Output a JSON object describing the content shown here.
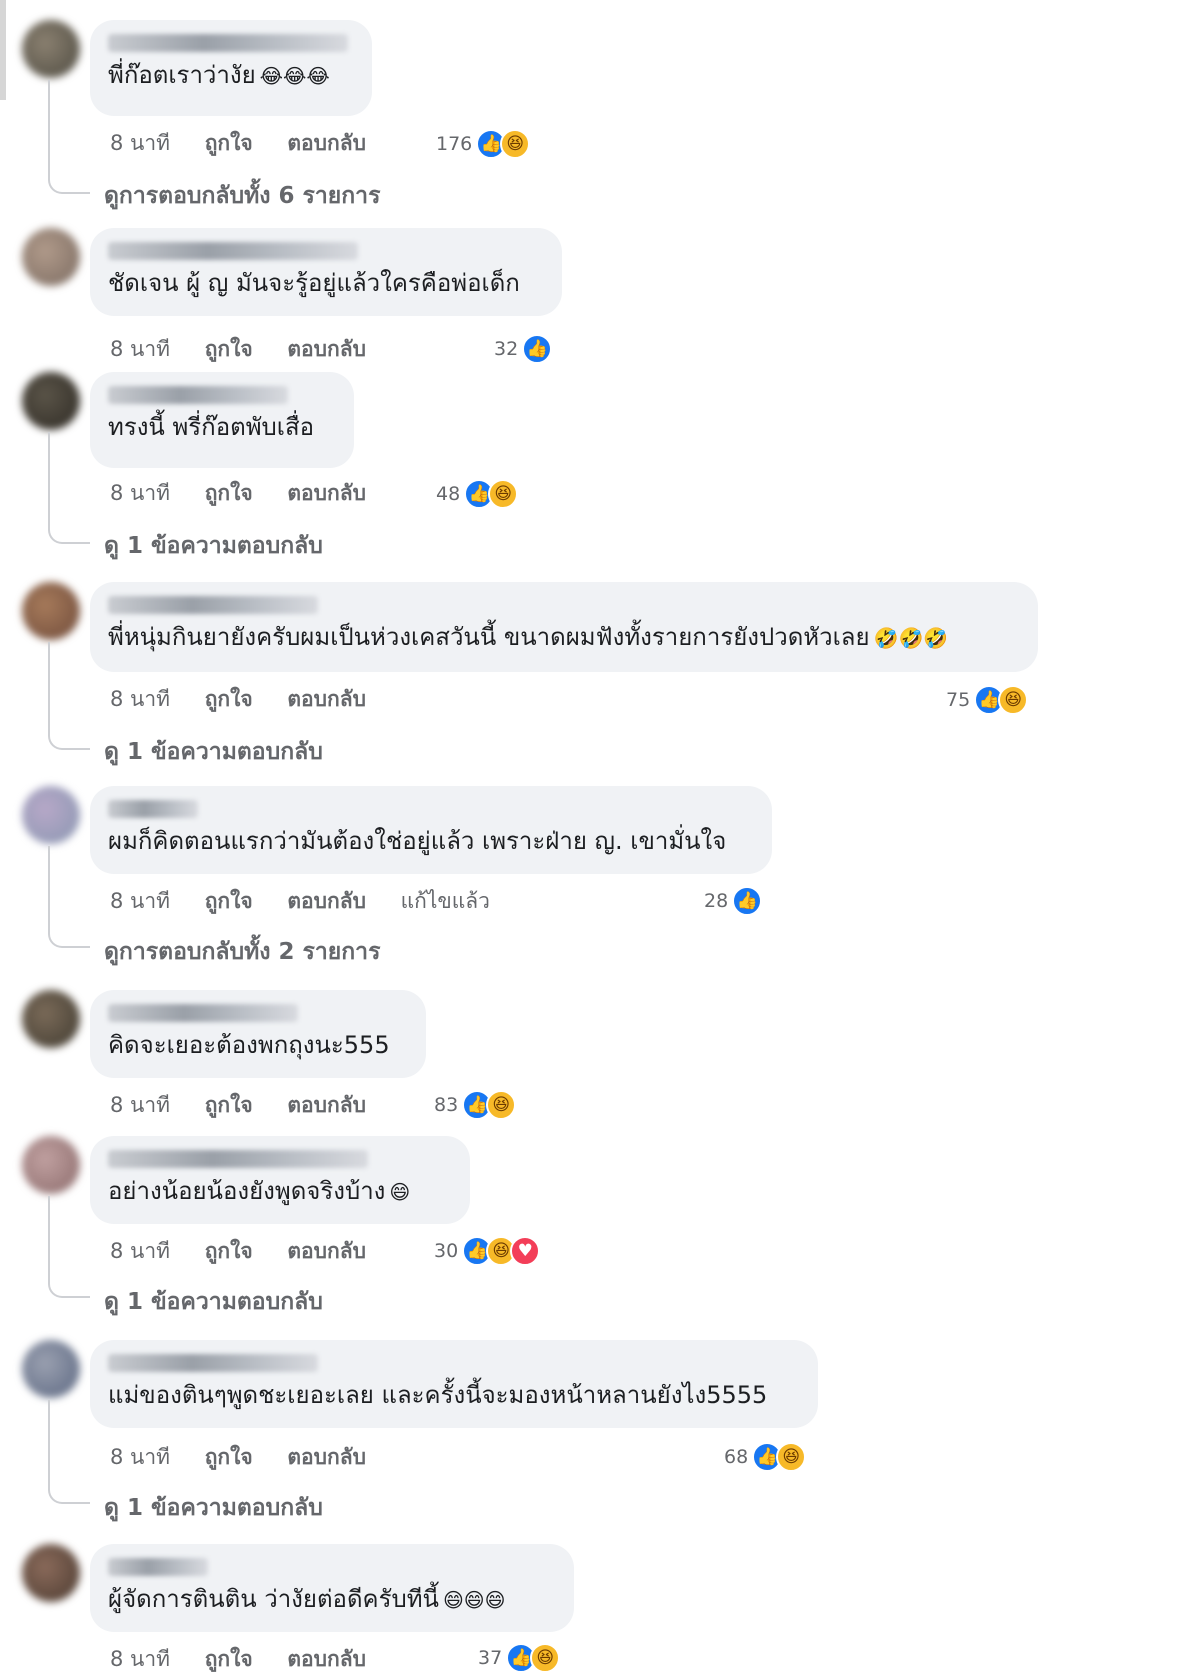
{
  "labels": {
    "time": "8 นาที",
    "like": "ถูกใจ",
    "reply": "ตอบกลับ",
    "edited": "แก้ไขแล้ว"
  },
  "comments": [
    {
      "text": "พี่ก๊อตเราว่างัย",
      "emoji": "😂😂😂",
      "count": "176",
      "reactions": [
        "like",
        "haha"
      ],
      "replies": "ดูการตอบกลับทั้ง 6 รายการ"
    },
    {
      "text": "ชัดเจน ผู้ ญ มันจะรู้อยู่แล้วใครคือพ่อเด็ก",
      "emoji": "",
      "count": "32",
      "reactions": [
        "like"
      ],
      "replies": ""
    },
    {
      "text": "ทรงนี้ พรี่ก๊อตพับเสื่อ",
      "emoji": "",
      "count": "48",
      "reactions": [
        "like",
        "haha"
      ],
      "replies": "ดู 1 ข้อความตอบกลับ"
    },
    {
      "text": "พี่หนุ่มกินยายังครับผมเป็นห่วงเคสวันนี้ ขนาดผมฟังทั้งรายการยังปวดหัวเลย",
      "emoji": "🤣🤣🤣",
      "count": "75",
      "reactions": [
        "like",
        "haha"
      ],
      "replies": "ดู 1 ข้อความตอบกลับ"
    },
    {
      "text": "ผมก็คิดตอนแรกว่ามันต้องใช่อยู่แล้ว เพราะฝ่าย ญ. เขามั่นใจ",
      "emoji": "",
      "count": "28",
      "reactions": [
        "like"
      ],
      "replies": "ดูการตอบกลับทั้ง 2 รายการ",
      "edited": true
    },
    {
      "text": "คิดจะเยอะต้องพกถุงนะ555",
      "emoji": "",
      "count": "83",
      "reactions": [
        "like",
        "haha"
      ],
      "replies": ""
    },
    {
      "text": "อย่างน้อยน้องยังพูดจริงบ้าง",
      "emoji": "😄",
      "count": "30",
      "reactions": [
        "like",
        "haha",
        "love"
      ],
      "replies": "ดู 1 ข้อความตอบกลับ"
    },
    {
      "text": "แม่ของตินๆพูดชะเยอะเลย และครั้งนี้จะมองหน้าหลานยังไง5555",
      "emoji": "",
      "count": "68",
      "reactions": [
        "like",
        "haha"
      ],
      "replies": "ดู 1 ข้อความตอบกลับ"
    },
    {
      "text": "ผู้จัดการตินติน ว่างัยต่อดีครับทีนี้",
      "emoji": "😄😄😄",
      "count": "37",
      "reactions": [
        "like",
        "haha"
      ],
      "replies": ""
    }
  ]
}
